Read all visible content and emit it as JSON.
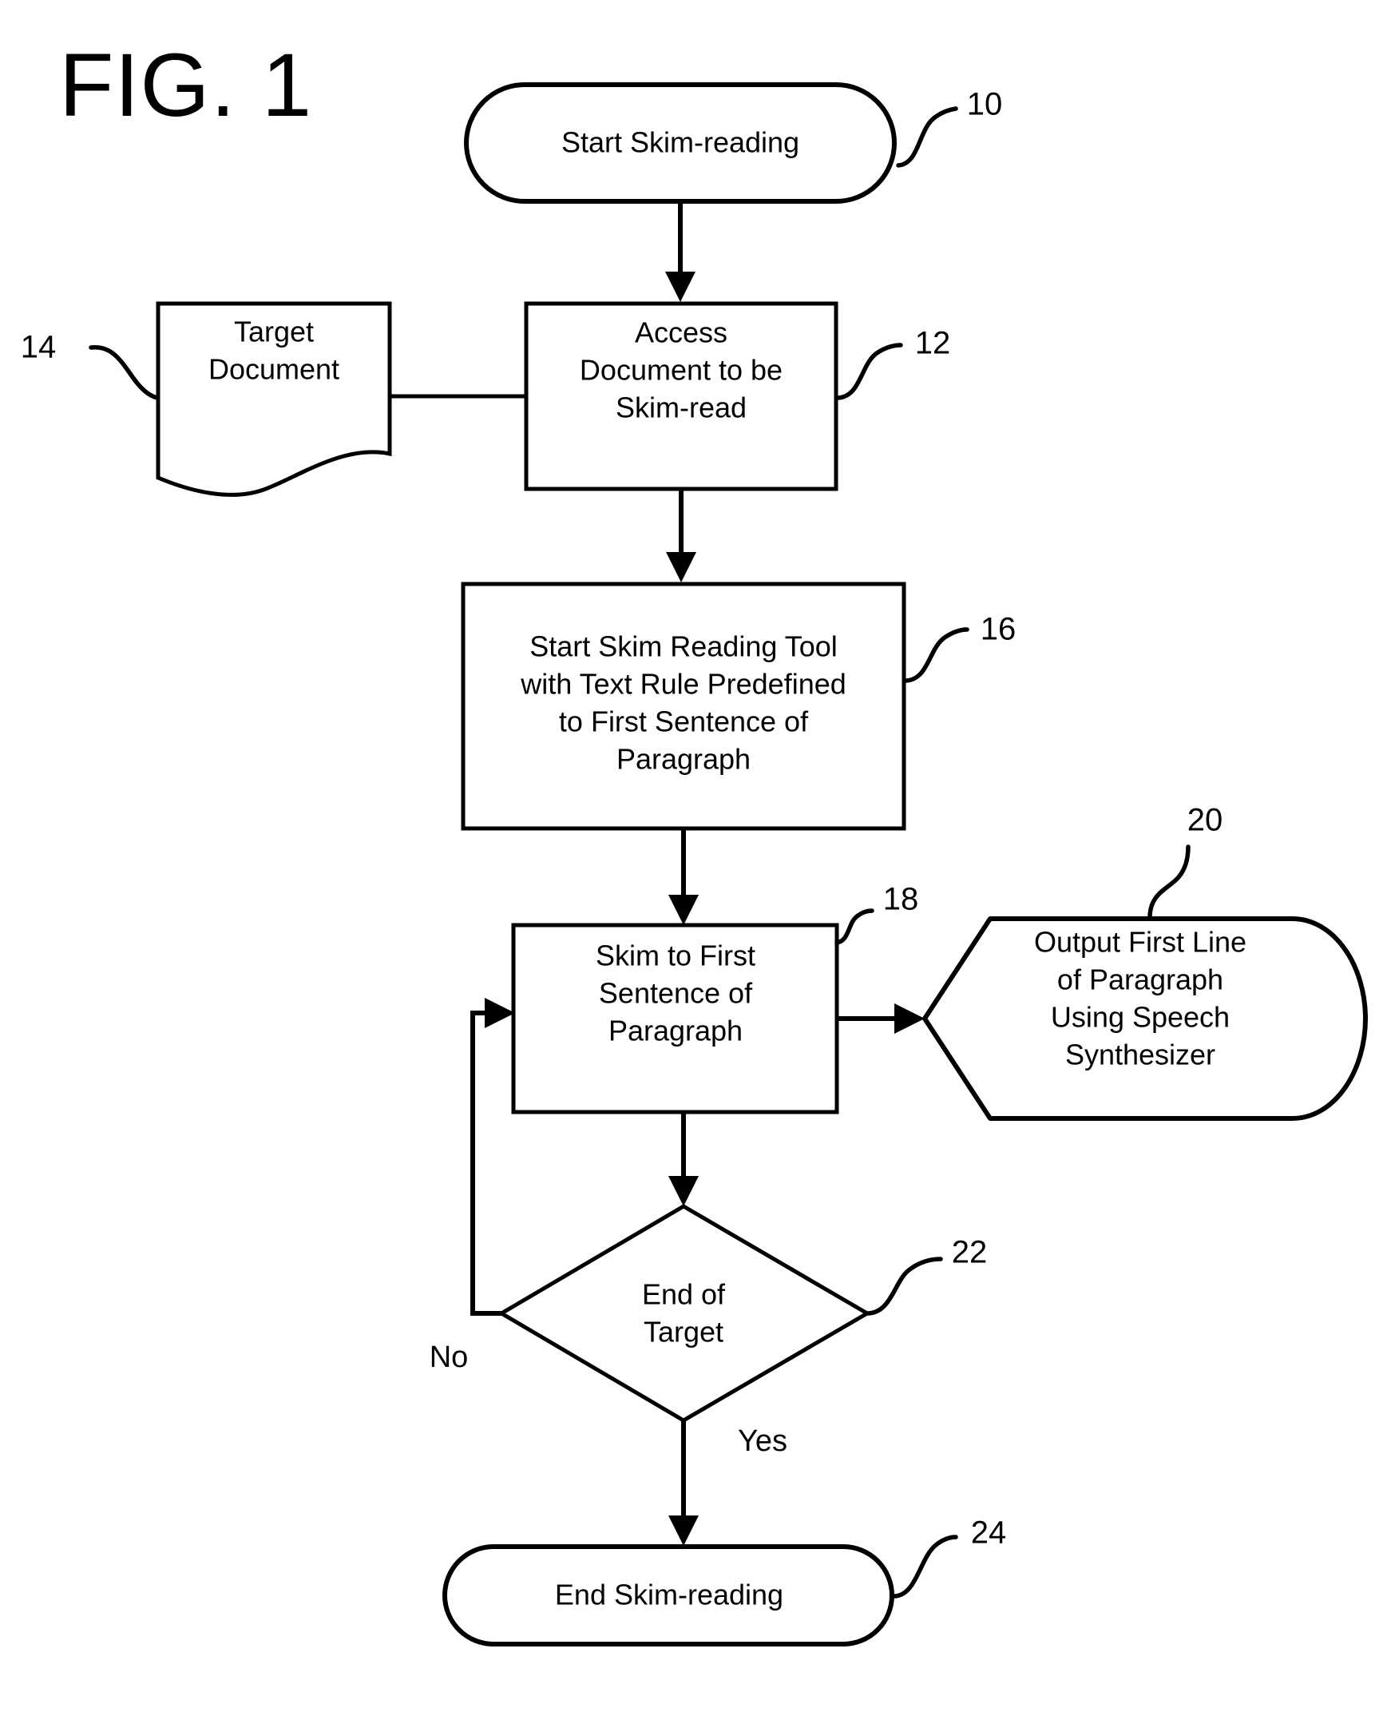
{
  "figure": {
    "title": "FIG. 1",
    "type": "patent-flowchart"
  },
  "nodes": {
    "start": {
      "ref": "10",
      "shape": "stadium",
      "label": "Start Skim-reading"
    },
    "target_document": {
      "ref": "14",
      "shape": "document",
      "label_line1": "Target",
      "label_line2": "Document"
    },
    "access_document": {
      "ref": "12",
      "shape": "process",
      "label_line1": "Access",
      "label_line2": "Document to be",
      "label_line3": "Skim-read"
    },
    "start_tool": {
      "ref": "16",
      "shape": "process",
      "label_line1": "Start Skim Reading Tool",
      "label_line2": "with Text Rule Predefined",
      "label_line3": "to First Sentence of",
      "label_line4": "Paragraph"
    },
    "skim_first_sentence": {
      "ref": "18",
      "shape": "process",
      "label_line1": "Skim to First",
      "label_line2": "Sentence of",
      "label_line3": "Paragraph"
    },
    "output_speech": {
      "ref": "20",
      "shape": "speech-output",
      "label_line1": "Output First Line",
      "label_line2": "of Paragraph",
      "label_line3": "Using Speech",
      "label_line4": "Synthesizer"
    },
    "end_of_target": {
      "ref": "22",
      "shape": "decision",
      "label_line1": "End of",
      "label_line2": "Target"
    },
    "end": {
      "ref": "24",
      "shape": "stadium",
      "label": "End Skim-reading"
    }
  },
  "edges": {
    "decision_no": "No",
    "decision_yes": "Yes"
  },
  "colors": {
    "stroke": "#000000",
    "fill": "#ffffff",
    "background": "#ffffff"
  }
}
